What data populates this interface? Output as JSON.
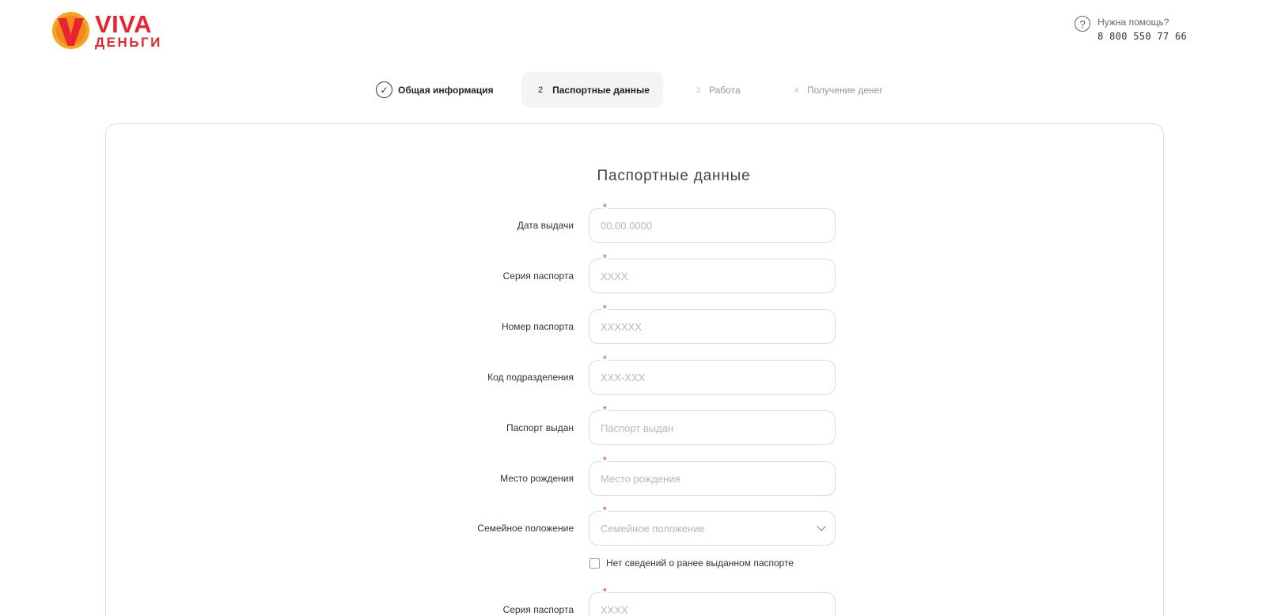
{
  "header": {
    "logo": {
      "line1": "VIVA",
      "line2": "ДЕНЬГИ",
      "brand_color": "#e8252e",
      "accent_color": "#f6a623"
    },
    "help": {
      "icon": "question-circle-icon",
      "label": "Нужна помощь?",
      "phone": "8 800 550 77 66"
    }
  },
  "stepper": {
    "steps": [
      {
        "num": "",
        "label": "Общая информация",
        "state": "done",
        "icon": "check-circle-icon"
      },
      {
        "num": "2",
        "label": "Паспортные данные",
        "state": "active"
      },
      {
        "num": "3",
        "label": "Работа",
        "state": "pending"
      },
      {
        "num": "4",
        "label": "Получение денег",
        "state": "pending"
      }
    ]
  },
  "form": {
    "title": "Паспортные данные",
    "required_mark": "*",
    "fields": [
      {
        "label": "Дата выдачи",
        "placeholder": "00.00.0000",
        "value": ""
      },
      {
        "label": "Серия паспорта",
        "placeholder": "XXXX",
        "value": ""
      },
      {
        "label": "Номер паспорта",
        "placeholder": "XXXXXX",
        "value": ""
      },
      {
        "label": "Код подразделения",
        "placeholder": "XXX-XXX",
        "value": ""
      },
      {
        "label": "Паспорт выдан",
        "placeholder": "Паспорт выдан",
        "value": ""
      },
      {
        "label": "Место рождения",
        "placeholder": "Место рождения",
        "value": ""
      },
      {
        "label": "Семейное положение",
        "placeholder": "Семейное положение",
        "value": "",
        "type": "select"
      }
    ],
    "checkbox": {
      "label": "Нет сведений о ранее выданном паспорте",
      "checked": false
    },
    "prev_passport_fields": [
      {
        "label": "Серия паспорта",
        "placeholder": "XXXX",
        "value": ""
      }
    ]
  }
}
